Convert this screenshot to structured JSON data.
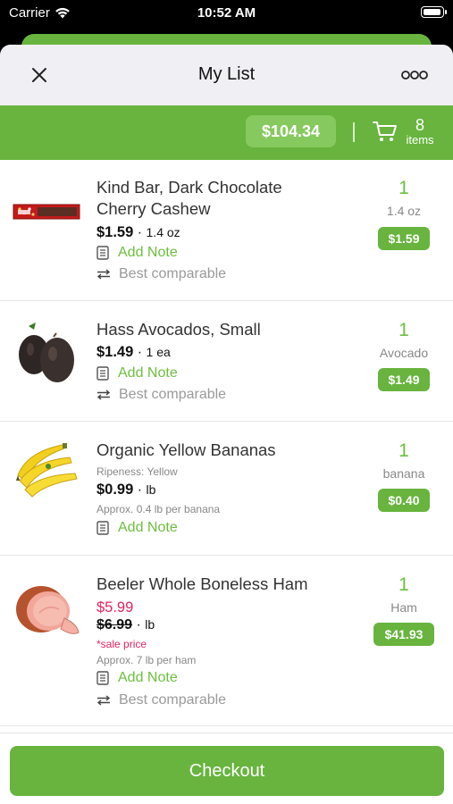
{
  "status": {
    "carrier": "Carrier",
    "time": "10:52 AM"
  },
  "header": {
    "title": "My List"
  },
  "summary": {
    "total": "$104.34",
    "count": "8",
    "count_label": "items"
  },
  "items": [
    {
      "name": "Kind Bar, Dark Chocolate Cherry Cashew",
      "price": "$1.59",
      "unit": "1.4 oz",
      "note": "Add Note",
      "comparable": "Best comparable",
      "qty": "1",
      "qty_label": "1.4 oz",
      "line_total": "$1.59",
      "icon": "kind-bar-image"
    },
    {
      "name": "Hass Avocados, Small",
      "price": "$1.49",
      "unit": "1 ea",
      "note": "Add Note",
      "comparable": "Best comparable",
      "qty": "1",
      "qty_label": "Avocado",
      "line_total": "$1.49",
      "icon": "avocado-image"
    },
    {
      "name": "Organic Yellow Bananas",
      "ripeness": "Ripeness: Yellow",
      "price": "$0.99",
      "unit": "lb",
      "approx": "Approx. 0.4 lb per banana",
      "note": "Add Note",
      "qty": "1",
      "qty_label": "banana",
      "line_total": "$0.40",
      "icon": "banana-image"
    },
    {
      "name": "Beeler Whole Boneless Ham",
      "sale_price": "$5.99",
      "price": "$6.99",
      "unit": "lb",
      "sale_tag": "*sale price",
      "approx": "Approx. 7 lb per ham",
      "note": "Add Note",
      "comparable": "Best comparable",
      "qty": "1",
      "qty_label": "Ham",
      "line_total": "$41.93",
      "icon": "ham-image"
    }
  ],
  "checkout": {
    "label": "Checkout"
  },
  "colors": {
    "brand_green": "#68b43e",
    "sale_red": "#e0245e",
    "link_green": "#6cbf3e"
  }
}
